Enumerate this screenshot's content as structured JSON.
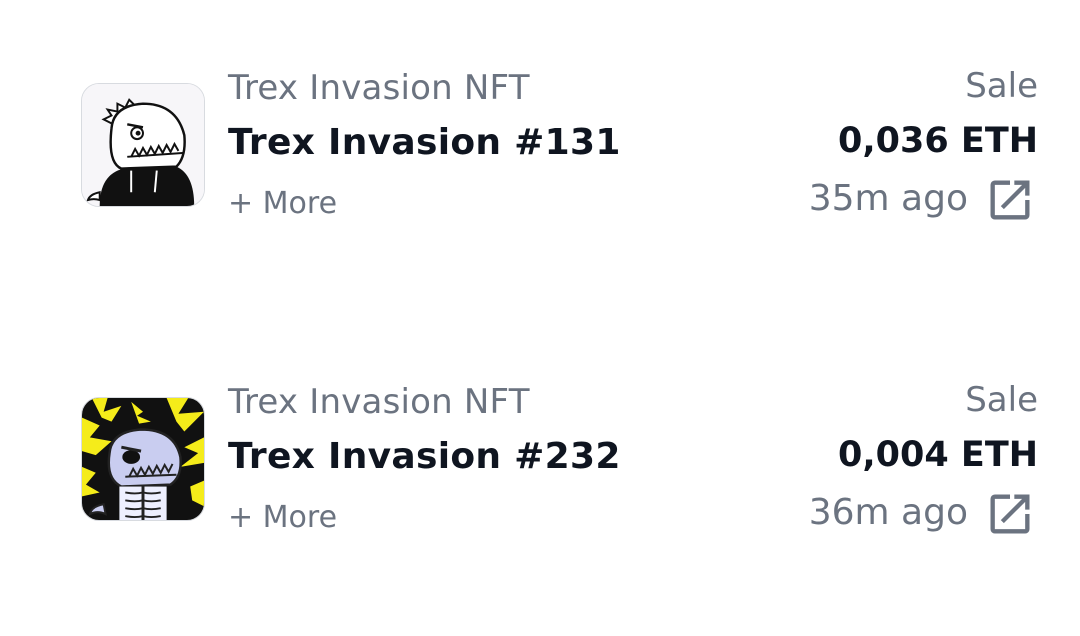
{
  "activity": [
    {
      "collection": "Trex Invasion NFT",
      "name": "Trex Invasion #131",
      "more_label": "+ More",
      "type": "Sale",
      "price": "0,036 ETH",
      "time": "35m ago",
      "thumbnail_icon": "trex-hoodie-image",
      "link_icon": "external-link-icon"
    },
    {
      "collection": "Trex Invasion NFT",
      "name": "Trex Invasion #232",
      "more_label": "+ More",
      "type": "Sale",
      "price": "0,004 ETH",
      "time": "36m ago",
      "thumbnail_icon": "trex-skeleton-image",
      "link_icon": "external-link-icon"
    }
  ],
  "colors": {
    "text_primary": "#0f1520",
    "text_secondary": "#6b7380",
    "background": "#ffffff",
    "lightning_yellow": "#f5ec1a"
  }
}
